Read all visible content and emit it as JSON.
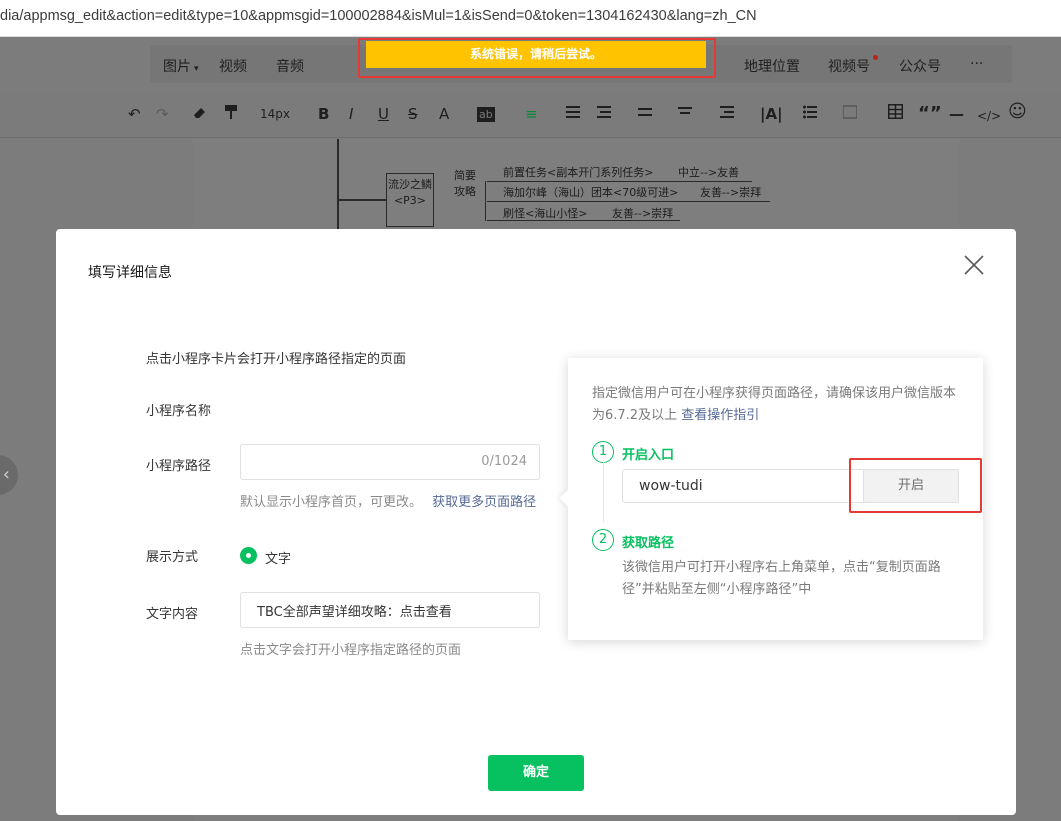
{
  "browser": {
    "url": "dia/appmsg_edit&action=edit&type=10&appmsgid=100002884&isMul=1&isSend=0&token=1304162430&lang=zh_CN"
  },
  "toast": {
    "text": "系统错误，请稍后尝试。",
    "color": "#ffc300"
  },
  "insert_bar": {
    "items": [
      "图片",
      "视频",
      "音频",
      "地理位置",
      "视频号",
      "公众号",
      "···"
    ],
    "image_suffix": "▾"
  },
  "format_bar": {
    "font_size": "14px",
    "items": [
      "↶",
      "↷",
      "B",
      "I",
      "U",
      "S",
      "A",
      "ab",
      "≡",
      "“”",
      "—",
      "</>",
      "☺"
    ]
  },
  "mindmap": {
    "node": "流沙之鳞<P3>",
    "branch": "简要攻略",
    "rows": [
      "前置任务<副本开门系列任务>",
      "中立-->友善",
      "海加尔峰（海山）团本<70级可进>",
      "友善-->崇拜",
      "刷怪<海山小怪>",
      "友善-->崇拜"
    ]
  },
  "modal": {
    "title": "填写详细信息",
    "intro": "点击小程序卡片会打开小程序路径指定的页面",
    "name_label": "小程序名称",
    "path_label": "小程序路径",
    "path_counter": "0/1024",
    "path_hint": "默认显示小程序首页，可更改。",
    "path_hint_link": "获取更多页面路径",
    "display_label": "展示方式",
    "display_option": "文字",
    "text_label": "文字内容",
    "text_value": "TBC全部声望详细攻略：点击查看",
    "text_hint": "点击文字会打开小程序指定路径的页面",
    "confirm": "确定"
  },
  "popover": {
    "desc": "指定微信用户可在小程序获得页面路径，请确保该用户微信版本为6.7.2及以上",
    "desc_link": "查看操作指引",
    "step1_num": "1",
    "step1_title": "开启入口",
    "wechat_id": "wow-tudi",
    "open_button": "开启",
    "step2_num": "2",
    "step2_title": "获取路径",
    "step2_desc": "该微信用户可打开小程序右上角菜单，点击“复制页面路径”并粘贴至左侧“小程序路径”中"
  },
  "colors": {
    "brand_green": "#07c160",
    "link_blue": "#576b95",
    "highlight_red": "#e53935"
  }
}
